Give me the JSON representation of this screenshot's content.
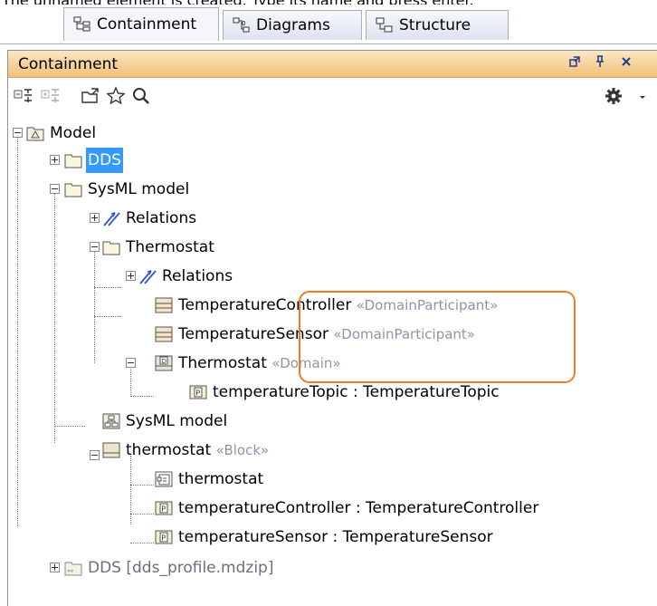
{
  "caption": "The unnamed element is created. Type its name and press enter.",
  "tabs": [
    {
      "label": "Containment",
      "icon": "containment-tree-icon"
    },
    {
      "label": "Diagrams",
      "icon": "diagrams-icon"
    },
    {
      "label": "Structure",
      "icon": "structure-icon"
    }
  ],
  "panel": {
    "title": "Containment",
    "buttons": [
      "float-icon",
      "pin-icon",
      "close-icon"
    ]
  },
  "toolbar": [
    "collapse-all-icon",
    "expand-all-icon",
    "open-folder-icon",
    "favorites-star-icon",
    "search-icon",
    "gear-icon",
    "chevron-down-icon"
  ],
  "tree": [
    {
      "label": "Model",
      "icon": "model-package-icon",
      "expanded": true
    },
    {
      "label": "DDS",
      "icon": "package-icon",
      "expanded": false,
      "selected": true
    },
    {
      "label": "SysML model",
      "icon": "package-icon",
      "expanded": true
    },
    {
      "label": "Relations",
      "icon": "relations-icon",
      "expanded": false
    },
    {
      "label": "Thermostat",
      "icon": "package-icon",
      "expanded": true
    },
    {
      "label": "Relations",
      "icon": "relations-icon",
      "expanded": false
    },
    {
      "label": "TemperatureController",
      "stereotype": "«DomainParticipant»",
      "icon": "block-icon"
    },
    {
      "label": "TemperatureSensor",
      "stereotype": "«DomainParticipant»",
      "icon": "block-icon"
    },
    {
      "label": "Thermostat",
      "stereotype": "«Domain»",
      "icon": "domain-icon",
      "expanded": true
    },
    {
      "label": "temperatureTopic : TemperatureTopic",
      "icon": "part-property-icon"
    },
    {
      "label": "SysML model",
      "icon": "diagram-icon"
    },
    {
      "label": "thermostat",
      "stereotype": "«Block»",
      "icon": "block-icon",
      "expanded": true
    },
    {
      "label": "thermostat",
      "icon": "ibd-diagram-icon"
    },
    {
      "label": "temperatureController : TemperatureController",
      "icon": "part-property-icon"
    },
    {
      "label": "temperatureSensor : TemperatureSensor",
      "icon": "part-property-icon"
    },
    {
      "label": "DDS [dds_profile.mdzip]",
      "icon": "profile-package-icon",
      "expanded": false
    }
  ]
}
